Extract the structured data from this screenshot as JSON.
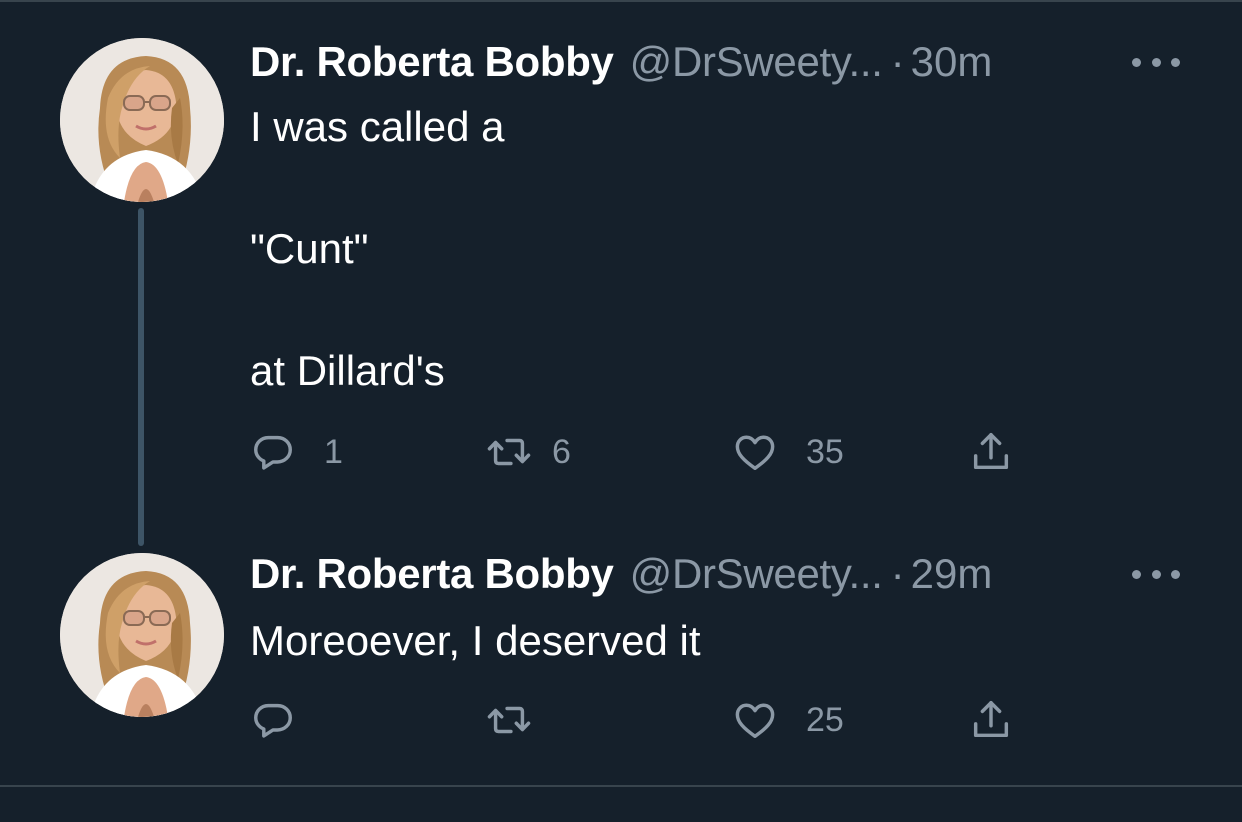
{
  "tweets": [
    {
      "display_name": "Dr. Roberta Bobby",
      "handle": "@DrSweety...",
      "separator": "·",
      "time": "30m",
      "text": "I was called a\n\n\"Cunt\"\n\nat Dillard's",
      "actions": {
        "reply_count": "1",
        "retweet_count": "6",
        "like_count": "35"
      }
    },
    {
      "display_name": "Dr. Roberta Bobby",
      "handle": "@DrSweety...",
      "separator": "·",
      "time": "29m",
      "text": "Moreoever, I deserved it",
      "actions": {
        "reply_count": "",
        "retweet_count": "",
        "like_count": "25"
      }
    }
  ],
  "icons": {
    "reply": "reply-icon",
    "retweet": "retweet-icon",
    "like": "heart-icon",
    "share": "share-icon",
    "more": "more-options-icon"
  },
  "colors": {
    "background": "#15202b",
    "text_primary": "#ffffff",
    "text_secondary": "#8b98a5",
    "thread_line": "#3d5466",
    "divider": "#38444d"
  }
}
